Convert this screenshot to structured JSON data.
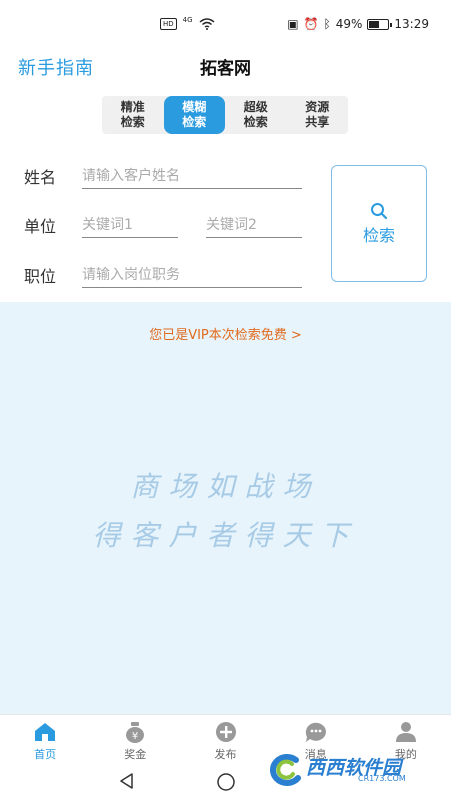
{
  "status_bar": {
    "hd": "HD",
    "signal": "4G",
    "battery_percent": "49%",
    "battery_level": 0.49,
    "time": "13:29"
  },
  "header": {
    "guide_link": "新手指南",
    "title": "拓客网"
  },
  "tabs": [
    {
      "label": "精准\n检索",
      "active": false
    },
    {
      "label": "模糊\n检索",
      "active": true
    },
    {
      "label": "超级\n检索",
      "active": false
    },
    {
      "label": "资源\n共享",
      "active": false
    }
  ],
  "form": {
    "name_label": "姓名",
    "name_placeholder": "请输入客户姓名",
    "unit_label": "单位",
    "keyword1_placeholder": "关键词1",
    "keyword2_placeholder": "关键词2",
    "position_label": "职位",
    "position_placeholder": "请输入岗位职务",
    "search_button": "检索"
  },
  "banner": {
    "vip_text": "您已是VIP本次检索免费 >",
    "slogan_line1": "商场如战场",
    "slogan_line2": "得客户者得天下"
  },
  "bottom_nav": [
    {
      "label": "首页",
      "icon": "home-icon",
      "active": true
    },
    {
      "label": "奖金",
      "icon": "money-bag-icon",
      "active": false
    },
    {
      "label": "发布",
      "icon": "plus-circle-icon",
      "active": false
    },
    {
      "label": "消息",
      "icon": "chat-icon",
      "active": false
    },
    {
      "label": "我的",
      "icon": "user-icon",
      "active": false
    }
  ],
  "watermark": {
    "text": "西西软件园",
    "sub": "CR173.COM"
  },
  "colors": {
    "accent": "#2b9be0",
    "vip": "#e06a1f",
    "banner_bg": "#e8f4fb"
  }
}
